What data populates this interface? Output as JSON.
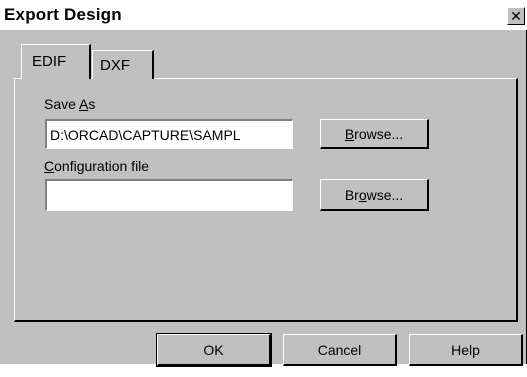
{
  "window": {
    "title": "Export Design"
  },
  "tabs": [
    {
      "label": "EDIF",
      "selected": true
    },
    {
      "label": "DXF",
      "selected": false
    }
  ],
  "edif": {
    "save_as_label_pre": "Save ",
    "save_as_label_key": "A",
    "save_as_label_post": "s",
    "save_as_value": "D:\\ORCAD\\CAPTURE\\SAMPL",
    "browse1_pre": "",
    "browse1_key": "B",
    "browse1_post": "rowse...",
    "config_label_key": "C",
    "config_label_post": "onfiguration file",
    "config_value": "",
    "browse2_pre": "Br",
    "browse2_key": "o",
    "browse2_post": "wse..."
  },
  "buttons": {
    "ok": "OK",
    "cancel": "Cancel",
    "help": "Help"
  },
  "icons": {
    "close": "close-icon"
  }
}
